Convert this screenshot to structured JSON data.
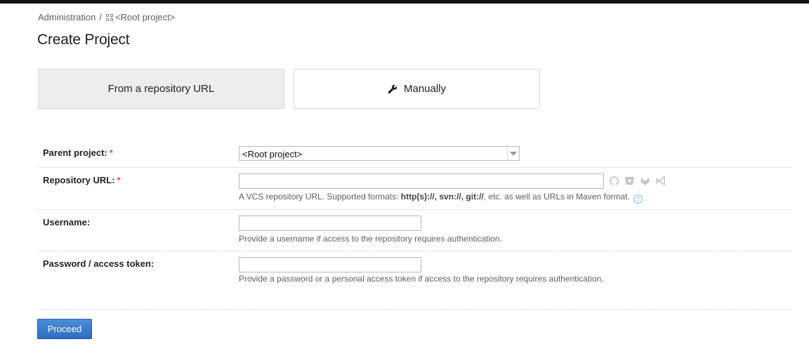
{
  "breadcrumb": {
    "root": "Administration",
    "separator": "/",
    "project_icon": "project-grid-icon",
    "project": "<Root project>"
  },
  "page_title": "Create Project",
  "tabs": [
    {
      "label": "From a repository URL",
      "active": true
    },
    {
      "label": "Manually",
      "icon": "wrench-icon",
      "active": false
    }
  ],
  "form": {
    "parent_project": {
      "label": "Parent project:",
      "required_mark": "*",
      "value": "<Root project>"
    },
    "repository_url": {
      "label": "Repository URL:",
      "required_mark": "*",
      "value": "",
      "note_prefix": "A VCS repository URL. Supported formats: ",
      "note_formats": "http(s)://, svn://, git://",
      "note_suffix": ", etc. as well as URLs in Maven format.",
      "help_icon": "?",
      "vcs_icons": [
        "github-icon",
        "bitbucket-icon",
        "gitlab-icon",
        "azure-devops-icon"
      ]
    },
    "username": {
      "label": "Username:",
      "value": "",
      "note": "Provide a username if access to the repository requires authentication."
    },
    "password": {
      "label": "Password / access token:",
      "value": "",
      "note": "Provide a password or a personal access token if access to the repository requires authentication."
    }
  },
  "actions": {
    "proceed_label": "Proceed"
  },
  "colors": {
    "primary_button": "#3a78c9",
    "required": "#d9545c",
    "active_tab_bg": "#eceded"
  }
}
